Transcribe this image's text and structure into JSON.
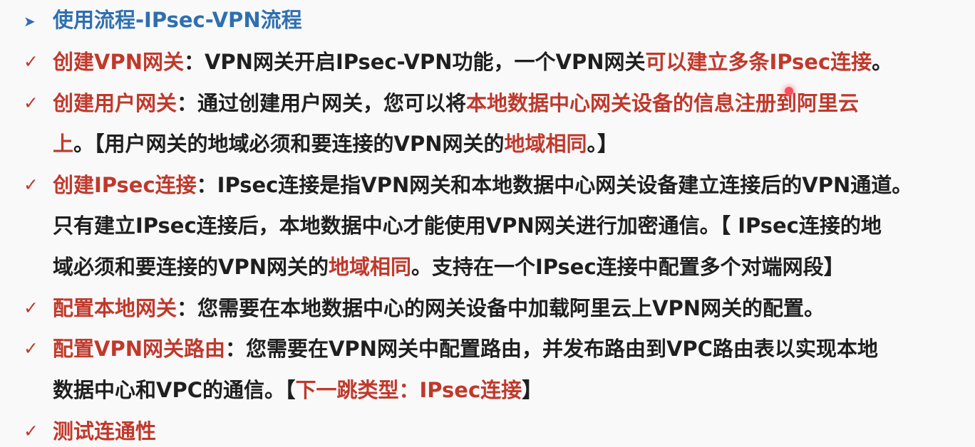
{
  "heading": {
    "bullet": "➤",
    "text": "使用流程-IPsec-VPN流程"
  },
  "items": [
    {
      "bullet": "✓",
      "line1": [
        {
          "text": "创建VPN网关",
          "tone": "red"
        },
        {
          "text": "：VPN网关开启IPsec-VPN功能，一个VPN网关",
          "tone": "dark"
        },
        {
          "text": "可以建立多条IPsec连接",
          "tone": "red"
        },
        {
          "text": "。",
          "tone": "dark"
        }
      ]
    },
    {
      "bullet": "✓",
      "line1": [
        {
          "text": "创建用户网关",
          "tone": "red"
        },
        {
          "text": "：通过创建用户网关，您可以将",
          "tone": "dark"
        },
        {
          "text": "本地数据中心网关设备的信息注册到阿里云",
          "tone": "red"
        }
      ],
      "line2": [
        {
          "text": "上",
          "tone": "red"
        },
        {
          "text": "。【用户网关的地域必须和要连接的VPN网关的",
          "tone": "dark"
        },
        {
          "text": "地域相同",
          "tone": "red"
        },
        {
          "text": "。】",
          "tone": "dark"
        }
      ]
    },
    {
      "bullet": "✓",
      "line1": [
        {
          "text": "创建IPsec连接",
          "tone": "red"
        },
        {
          "text": "：IPsec连接是指VPN网关和本地数据中心网关设备建立连接后的VPN通道。",
          "tone": "dark"
        }
      ],
      "line2": [
        {
          "text": "只有建立IPsec连接后，本地数据中心才能使用VPN网关进行加密通信。【 IPsec连接的地",
          "tone": "dark"
        }
      ],
      "line3": [
        {
          "text": "域必须和要连接的VPN网关的",
          "tone": "dark"
        },
        {
          "text": "地域相同",
          "tone": "red"
        },
        {
          "text": "。支持在一个IPsec连接中配置多个对端网段】",
          "tone": "dark"
        }
      ]
    },
    {
      "bullet": "✓",
      "line1": [
        {
          "text": "配置本地网关",
          "tone": "red"
        },
        {
          "text": "：您需要在本地数据中心的网关设备中加载阿里云上VPN网关的配置。",
          "tone": "dark"
        }
      ]
    },
    {
      "bullet": "✓",
      "line1": [
        {
          "text": "配置VPN网关路由",
          "tone": "red"
        },
        {
          "text": "：您需要在VPN网关中配置路由，并发布路由到VPC路由表以实现本地",
          "tone": "dark"
        }
      ],
      "line2": [
        {
          "text": "数据中心和VPC的通信。【",
          "tone": "dark"
        },
        {
          "text": "下一跳类型：IPsec连接",
          "tone": "red"
        },
        {
          "text": "】",
          "tone": "dark"
        }
      ]
    },
    {
      "bullet": "✓",
      "line1": [
        {
          "text": "测试连通性",
          "tone": "red"
        }
      ]
    }
  ],
  "colors": {
    "heading": "#2f6fb0",
    "highlight": "#c0392b",
    "body": "#1f1f1f",
    "background": "#f9f9fa",
    "pointer": "#ff4d5a"
  }
}
